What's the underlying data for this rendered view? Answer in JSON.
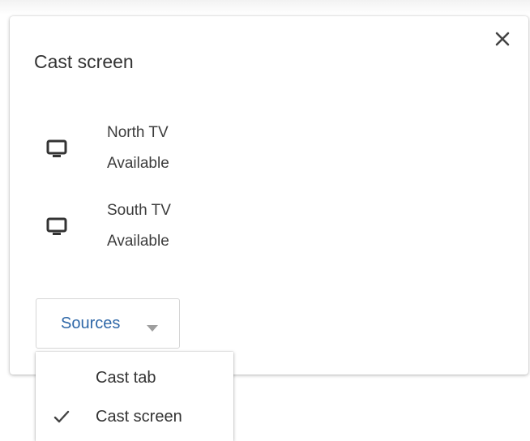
{
  "dialog": {
    "title": "Cast screen",
    "close_icon": "close-icon"
  },
  "sinks": [
    {
      "name": "North TV",
      "status": "Available",
      "icon": "monitor-icon"
    },
    {
      "name": "South TV",
      "status": "Available",
      "icon": "monitor-icon"
    }
  ],
  "sources": {
    "label": "Sources",
    "caret_icon": "caret-down-icon"
  },
  "sources_menu": {
    "items": [
      {
        "label": "Cast tab",
        "checked": false
      },
      {
        "label": "Cast screen",
        "checked": true
      }
    ]
  },
  "colors": {
    "accent": "#2f68a8",
    "text": "#333333",
    "icon": "#333333"
  }
}
